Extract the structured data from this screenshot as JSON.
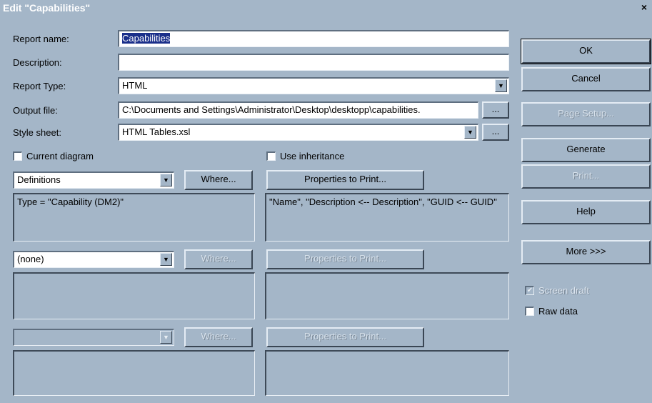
{
  "window": {
    "title": "Edit \"Capabilities\"",
    "close_glyph": "×"
  },
  "form": {
    "report_name": {
      "label": "Report name:",
      "value": "Capabilities"
    },
    "description": {
      "label": "Description:",
      "value": ""
    },
    "report_type": {
      "label": "Report Type:",
      "value": "HTML"
    },
    "output_file": {
      "label": "Output file:",
      "value": "C:\\Documents and Settings\\Administrator\\Desktop\\desktopp\\capabilities.",
      "browse_label": "..."
    },
    "style_sheet": {
      "label": "Style sheet:",
      "value": "HTML Tables.xsl",
      "browse_label": "..."
    },
    "current_diagram": {
      "label": "Current diagram",
      "checked": false
    },
    "use_inheritance": {
      "label": "Use inheritance",
      "checked": false
    }
  },
  "rows": [
    {
      "combo_value": "Definitions",
      "where_label": "Where...",
      "props_label": "Properties to Print...",
      "where_text": "Type = \"Capability (DM2)\"",
      "props_text": "\"Name\", \"Description <-- Description\", \"GUID <-- GUID\""
    },
    {
      "combo_value": "(none)",
      "where_label": "Where...",
      "props_label": "Properties to Print...",
      "where_text": "",
      "props_text": ""
    },
    {
      "combo_value": "",
      "where_label": "Where...",
      "props_label": "Properties to Print...",
      "where_text": "",
      "props_text": ""
    }
  ],
  "buttons": {
    "ok": "OK",
    "cancel": "Cancel",
    "page_setup": "Page Setup...",
    "generate": "Generate",
    "print": "Print...",
    "help": "Help",
    "more": "More >>>"
  },
  "options": {
    "screen_draft": {
      "label": "Screen draft",
      "checked": true
    },
    "raw_data": {
      "label": "Raw data",
      "checked": false
    }
  },
  "icons": {
    "dropdown": "chevron-down-icon",
    "check": "checkmark-icon"
  }
}
